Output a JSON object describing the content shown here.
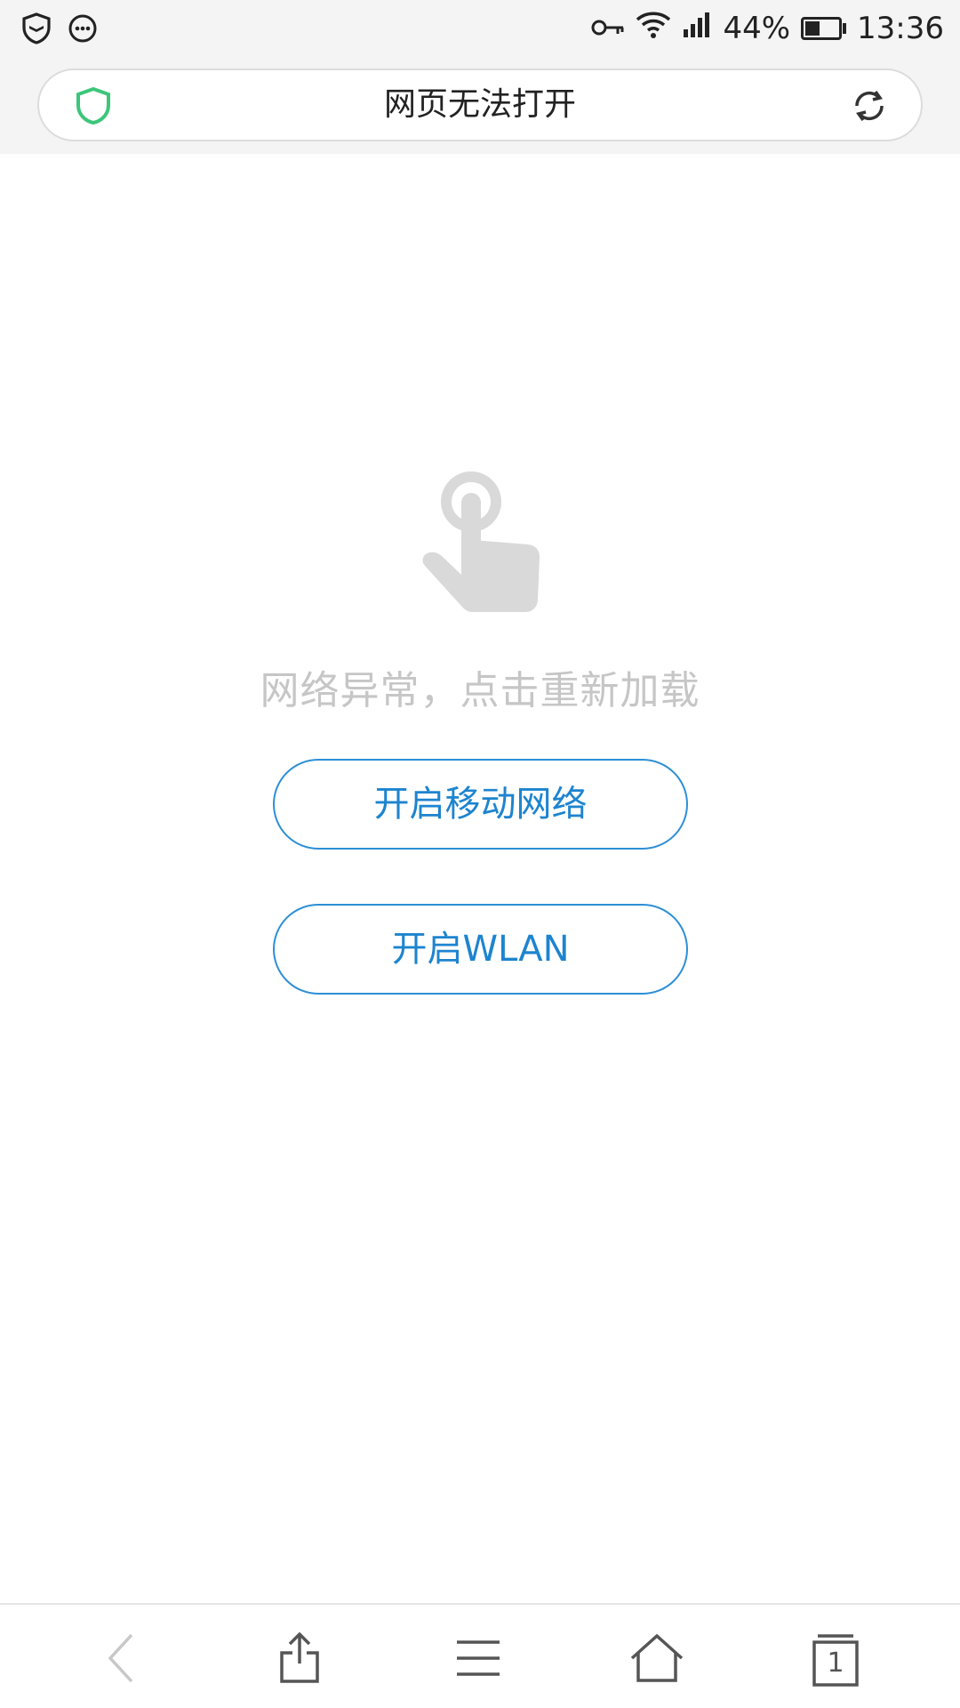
{
  "status_bar": {
    "battery_percent": "44%",
    "battery_level": 0.44,
    "time": "13:36",
    "icons": [
      "shield-icon",
      "chat-icon",
      "key-icon",
      "wifi-icon",
      "signal-icon",
      "battery-icon"
    ]
  },
  "address_bar": {
    "title": "网页无法打开",
    "security_icon": "shield-icon",
    "security_color": "#3cc67a",
    "reload_icon": "reload-icon"
  },
  "error": {
    "icon": "hand-tap-icon",
    "message": "网络异常，点击重新加载"
  },
  "actions": {
    "mobile_network_label": "开启移动网络",
    "wlan_label": "开启WLAN"
  },
  "bottom_nav": {
    "back_icon": "back-icon",
    "share_icon": "share-icon",
    "menu_icon": "menu-icon",
    "home_icon": "home-icon",
    "tabs_icon": "tabs-icon",
    "tabs_count": "1"
  },
  "colors": {
    "accent": "#1d84cf",
    "muted_text": "#c6c6c6",
    "top_bar_bg": "#f3f4f3"
  }
}
